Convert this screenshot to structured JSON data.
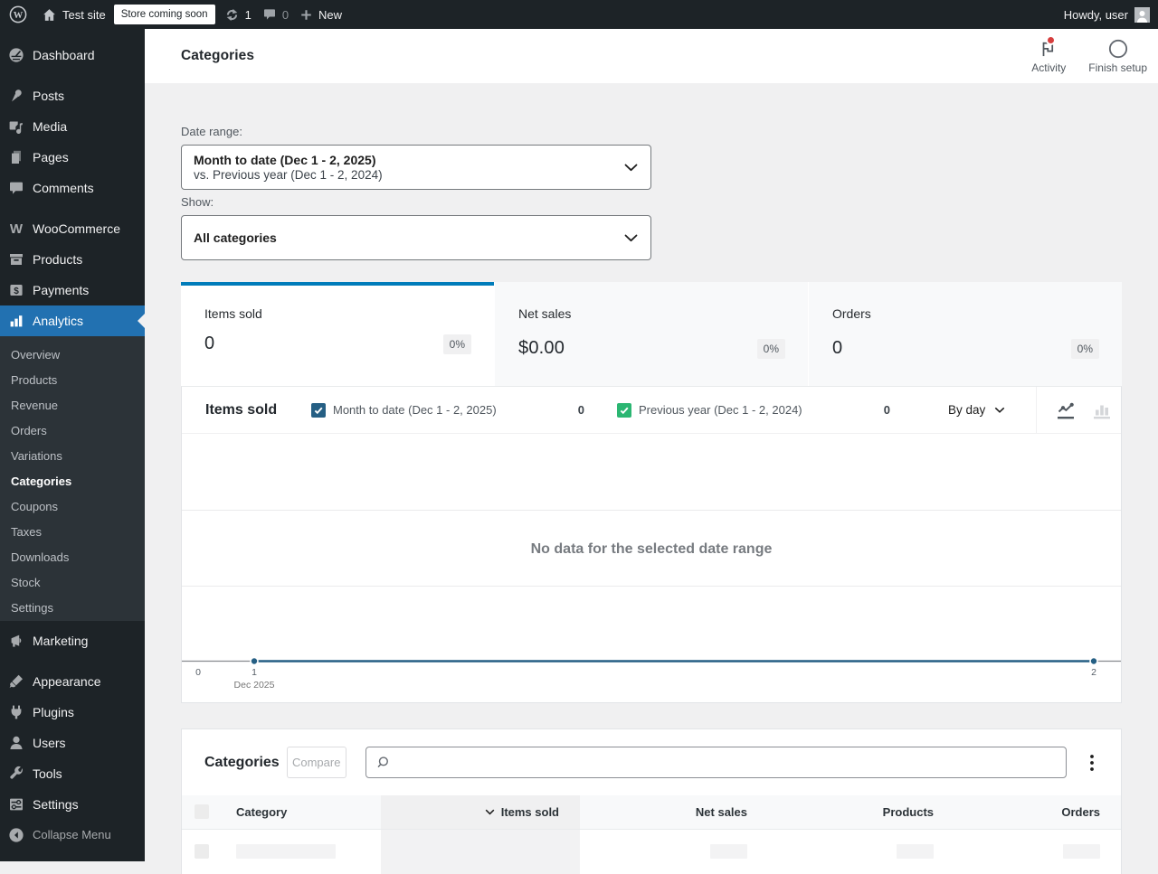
{
  "admin_bar": {
    "site_name": "Test site",
    "badge": "Store coming soon",
    "updates_count": "1",
    "comments_count": "0",
    "new_label": "New",
    "howdy": "Howdy, user"
  },
  "sidebar": {
    "items": [
      {
        "label": "Dashboard"
      },
      {
        "label": "Posts"
      },
      {
        "label": "Media"
      },
      {
        "label": "Pages"
      },
      {
        "label": "Comments"
      },
      {
        "label": "WooCommerce"
      },
      {
        "label": "Products"
      },
      {
        "label": "Payments"
      },
      {
        "label": "Analytics"
      },
      {
        "label": "Marketing"
      },
      {
        "label": "Appearance"
      },
      {
        "label": "Plugins"
      },
      {
        "label": "Users"
      },
      {
        "label": "Tools"
      },
      {
        "label": "Settings"
      }
    ],
    "analytics_submenu": [
      {
        "label": "Overview"
      },
      {
        "label": "Products"
      },
      {
        "label": "Revenue"
      },
      {
        "label": "Orders"
      },
      {
        "label": "Variations"
      },
      {
        "label": "Categories",
        "current": true
      },
      {
        "label": "Coupons"
      },
      {
        "label": "Taxes"
      },
      {
        "label": "Downloads"
      },
      {
        "label": "Stock"
      },
      {
        "label": "Settings"
      }
    ],
    "collapse_label": "Collapse Menu"
  },
  "header": {
    "title": "Categories",
    "activity_label": "Activity",
    "finish_setup_label": "Finish setup"
  },
  "filters": {
    "date_range_label": "Date range:",
    "date_range_value": "Month to date (Dec 1 - 2, 2025)",
    "date_range_compare": "vs. Previous year (Dec 1 - 2, 2024)",
    "show_label": "Show:",
    "show_value": "All categories"
  },
  "summary_cards": [
    {
      "label": "Items sold",
      "value": "0",
      "delta": "0%"
    },
    {
      "label": "Net sales",
      "value": "$0.00",
      "delta": "0%"
    },
    {
      "label": "Orders",
      "value": "0",
      "delta": "0%"
    }
  ],
  "chart": {
    "title": "Items sold",
    "legend": [
      {
        "label": "Month to date (Dec 1 - 2, 2025)",
        "value": "0",
        "color": "#255f84"
      },
      {
        "label": "Previous year (Dec 1 - 2, 2024)",
        "value": "0",
        "color": "#2bb672"
      }
    ],
    "interval": "By day",
    "empty_message": "No data for the selected date range",
    "y_zero_label": "0",
    "x_tick_1": "1",
    "x_tick_2": "2",
    "x_sub_label": "Dec 2025"
  },
  "chart_data": {
    "type": "line",
    "title": "Items sold",
    "x": [
      "Dec 1 2025",
      "Dec 2 2025"
    ],
    "series": [
      {
        "name": "Month to date (Dec 1 - 2, 2025)",
        "values": [
          0,
          0
        ],
        "color": "#255f84"
      },
      {
        "name": "Previous year (Dec 1 - 2, 2024)",
        "values": [
          0,
          0
        ],
        "color": "#2bb672"
      }
    ],
    "ylim": [
      0,
      3
    ],
    "x_ticks": [
      "1",
      "2"
    ],
    "annotation": "No data for the selected date range"
  },
  "table": {
    "title": "Categories",
    "compare_label": "Compare",
    "search_placeholder": "",
    "columns": [
      {
        "label": "Category"
      },
      {
        "label": "Items sold",
        "sorted": true
      },
      {
        "label": "Net sales"
      },
      {
        "label": "Products"
      },
      {
        "label": "Orders"
      }
    ]
  },
  "colors": {
    "accent_blue": "#2271b1",
    "summary_selected_bar": "#007cba",
    "chart_primary": "#255f84",
    "chart_secondary": "#2bb672",
    "notification_red": "#d94f4f"
  }
}
